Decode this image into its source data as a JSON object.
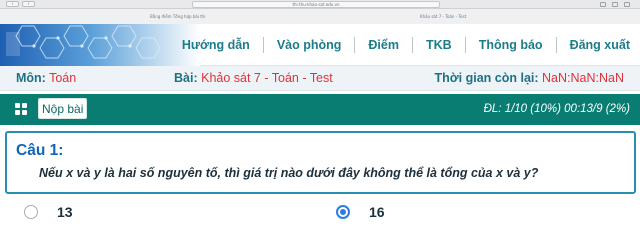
{
  "browser": {
    "url": "thi-thu-khao-sat.edu.vn",
    "back_label": "‹",
    "forward_label": "›",
    "tabs": [
      "Bằng điểm Tổng hợp bài thi",
      "Khảo sát 7 - Toán - Test"
    ]
  },
  "nav": {
    "items": [
      {
        "id": "huong-dan",
        "label": "Hướng dẫn"
      },
      {
        "id": "vao-phong",
        "label": "Vào phòng"
      },
      {
        "id": "diem",
        "label": "Điểm"
      },
      {
        "id": "tkb",
        "label": "TKB"
      },
      {
        "id": "thong-bao",
        "label": "Thông báo"
      },
      {
        "id": "dang-xuat",
        "label": "Đăng xuất"
      }
    ]
  },
  "info": {
    "subject_label": "Môn:",
    "subject_value": "Toán",
    "test_label": "Bài:",
    "test_value": "Khảo sát 7 - Toán - Test",
    "time_label": "Thời gian còn lại:",
    "time_value": "NaN:NaN:NaN"
  },
  "toolbar": {
    "submit_label": "Nộp bài",
    "progress_text": "ĐL: 1/10 (10%)   00:13/9 (2%)"
  },
  "question": {
    "number_label": "Câu 1:",
    "text": "Nếu x và y là hai số nguyên tố, thì giá trị nào dưới đây không thể là tổng của x và y?"
  },
  "answers": [
    {
      "label": "13",
      "selected": false
    },
    {
      "label": "16",
      "selected": true
    }
  ],
  "colors": {
    "accent_teal": "#0a7d72",
    "nav_text": "#1b7d8a",
    "value_red": "#e0323a",
    "question_blue": "#0f66b8",
    "radio_selected": "#2d7ce0"
  }
}
